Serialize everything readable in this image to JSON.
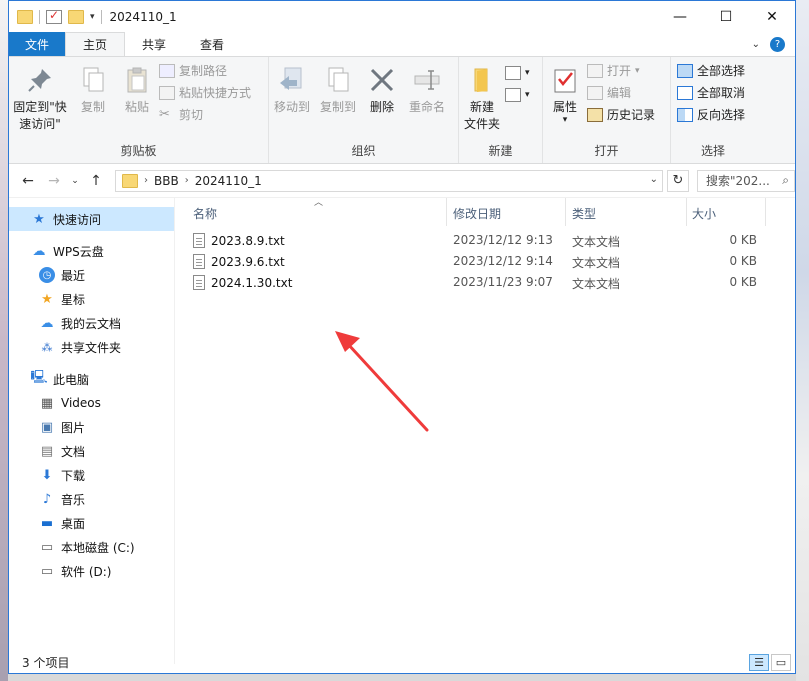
{
  "window": {
    "title": "2024110_1",
    "controls": {
      "minimize": "—",
      "maximize": "☐",
      "close": "✕"
    }
  },
  "ribbon_tabs": [
    {
      "label": "文件"
    },
    {
      "label": "主页"
    },
    {
      "label": "共享"
    },
    {
      "label": "查看"
    }
  ],
  "ribbon": {
    "clipboard": {
      "label": "剪贴板",
      "pin": "固定到\"快\n速访问\"",
      "copy": "复制",
      "paste": "粘贴",
      "copy_path": "复制路径",
      "paste_shortcut": "粘贴快捷方式",
      "cut": "剪切"
    },
    "organize": {
      "label": "组织",
      "move_to": "移动到",
      "copy_to": "复制到",
      "delete": "删除",
      "rename": "重命名"
    },
    "new": {
      "label": "新建",
      "new_folder": "新建\n文件夹"
    },
    "open": {
      "label": "打开",
      "properties": "属性",
      "open": "打开",
      "edit": "编辑",
      "history": "历史记录"
    },
    "select": {
      "label": "选择",
      "select_all": "全部选择",
      "select_none": "全部取消",
      "invert": "反向选择"
    }
  },
  "address": {
    "crumbs": [
      "BBB",
      "2024110_1"
    ],
    "search_placeholder": "搜索\"202..."
  },
  "nav": {
    "quick_access": "快速访问",
    "wps_cloud": "WPS云盘",
    "recent": "最近",
    "starred": "星标",
    "my_cloud_docs": "我的云文档",
    "shared_folder": "共享文件夹",
    "this_pc": "此电脑",
    "videos": "Videos",
    "pictures": "图片",
    "documents": "文档",
    "downloads": "下载",
    "music": "音乐",
    "desktop": "桌面",
    "local_disk": "本地磁盘 (C:)",
    "software_disk": "软件 (D:)"
  },
  "columns": {
    "name": "名称",
    "date": "修改日期",
    "type": "类型",
    "size": "大小"
  },
  "files": [
    {
      "name": "2023.8.9.txt",
      "date": "2023/12/12 9:13",
      "type": "文本文档",
      "size": "0 KB"
    },
    {
      "name": "2023.9.6.txt",
      "date": "2023/12/12 9:14",
      "type": "文本文档",
      "size": "0 KB"
    },
    {
      "name": "2024.1.30.txt",
      "date": "2023/11/23 9:07",
      "type": "文本文档",
      "size": "0 KB"
    }
  ],
  "status": {
    "item_count": "3 个项目"
  },
  "colors": {
    "accent": "#1979ca",
    "selection": "#cce8ff",
    "annotation_arrow": "#ef3b3b"
  }
}
